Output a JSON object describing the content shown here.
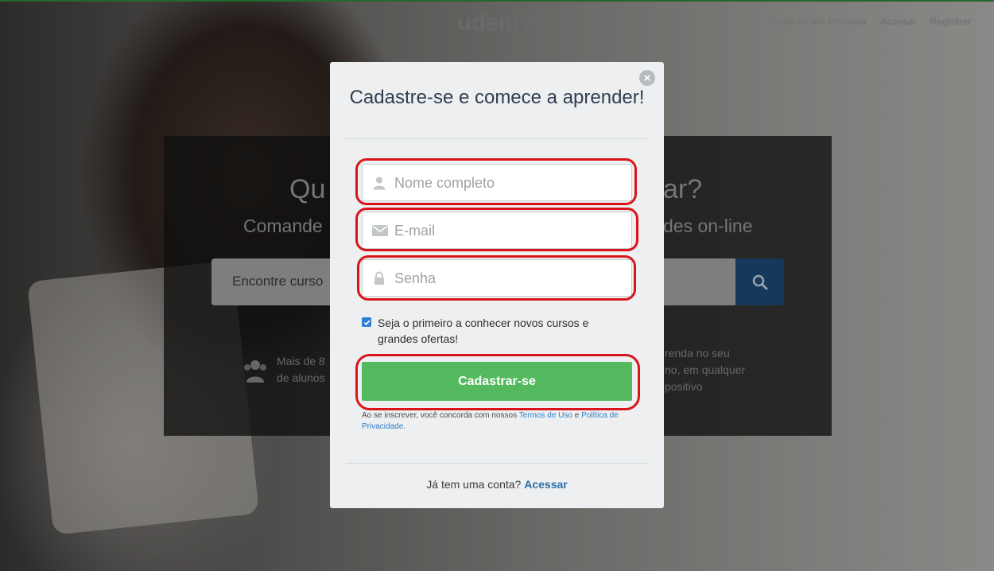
{
  "brand": {
    "logo": "udemy"
  },
  "topnav": {
    "instructor": "Torne-se um Instrutor",
    "login": "Acessar",
    "register": "Registrar"
  },
  "hero": {
    "question_left": "Qu",
    "question_right": "ar?",
    "subtitle_left": "Comande",
    "subtitle_right": "des on-line",
    "search_placeholder": "Encontre curso",
    "features": {
      "students_line1": "Mais de 8",
      "students_line2": "de alunos",
      "anywhere_line1": "renda no seu",
      "anywhere_line2": "no, em qualquer",
      "anywhere_line3": "positivo"
    }
  },
  "modal": {
    "title": "Cadastre-se e comece a aprender!",
    "fields": {
      "name_placeholder": "Nome completo",
      "email_placeholder": "E-mail",
      "password_placeholder": "Senha"
    },
    "optin": {
      "checked": true,
      "label": "Seja o primeiro a conhecer novos cursos e grandes ofertas!"
    },
    "submit_label": "Cadastrar-se",
    "terms": {
      "prefix": "Ao se inscrever, você concorda com nossos",
      "terms_link": "Termos de Uso",
      "conjunction": "e",
      "privacy_link": "Política de Privacidade",
      "suffix": "."
    },
    "login_prompt": "Já tem uma conta?",
    "login_link": "Acessar",
    "close_symbol": "×"
  },
  "colors": {
    "accent_green": "#54b95e",
    "highlight_red": "#d9151b",
    "link_blue": "#2f80c8",
    "search_button": "#1c4c7a"
  },
  "icons": [
    "user-icon",
    "envelope-icon",
    "lock-icon",
    "search-icon",
    "users-icon",
    "close-icon",
    "checkmark-icon"
  ]
}
